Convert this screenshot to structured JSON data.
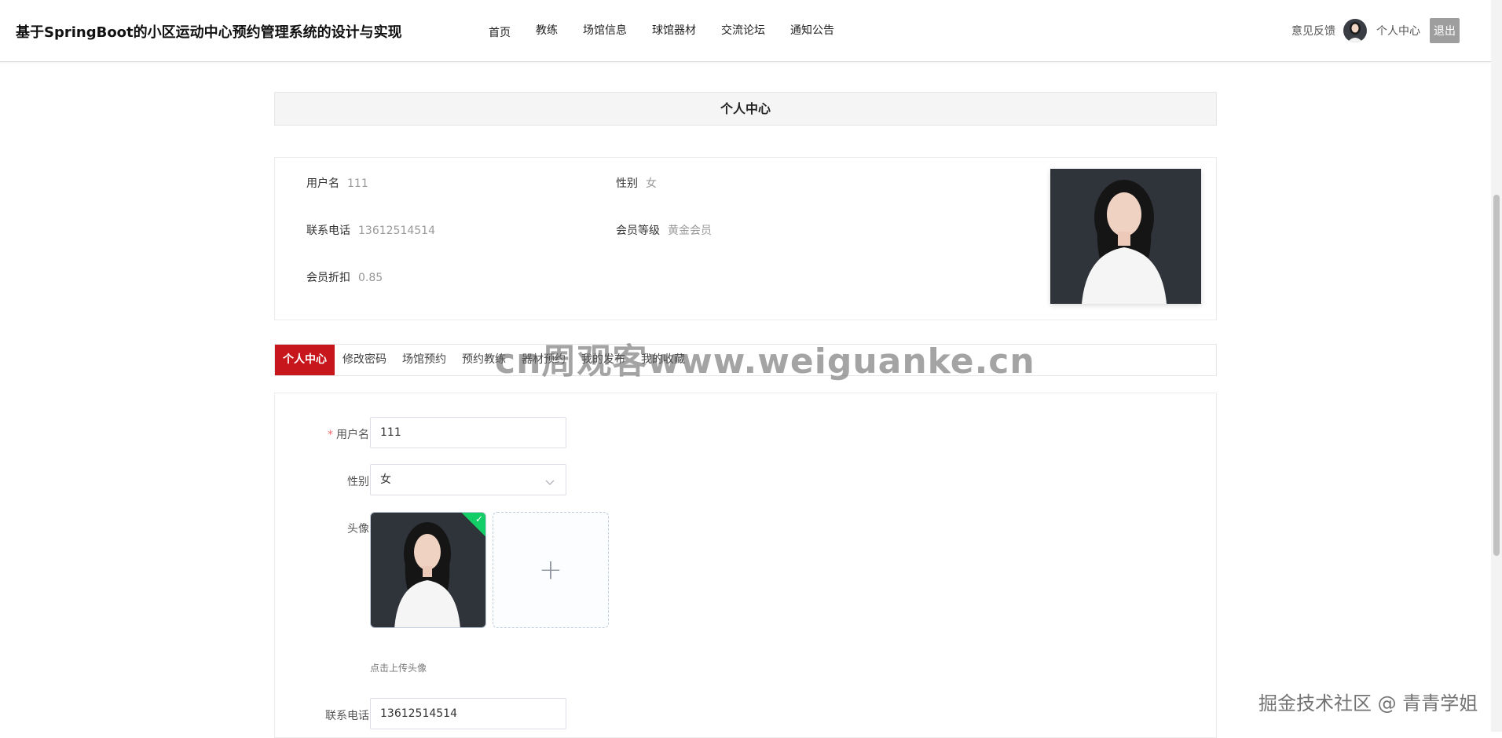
{
  "header": {
    "site_title": "基于SpringBoot的小区运动中心预约管理系统的设计与实现",
    "nav": [
      "首页",
      "教练",
      "场馆信息",
      "球馆器材",
      "交流论坛",
      "通知公告"
    ],
    "feedback": "意见反馈",
    "user_center": "个人中心",
    "logout": "退出"
  },
  "page_title": "个人中心",
  "profile": {
    "username_label": "用户名",
    "username": "111",
    "gender_label": "性别",
    "gender": "女",
    "phone_label": "联系电话",
    "phone": "13612514514",
    "level_label": "会员等级",
    "level": "黄金会员",
    "discount_label": "会员折扣",
    "discount": "0.85"
  },
  "tabs": [
    "个人中心",
    "修改密码",
    "场馆预约",
    "预约教练",
    "器材预约",
    "我的发布",
    "我的收藏"
  ],
  "form": {
    "username_label": "用户名",
    "username_value": "111",
    "gender_label": "性别",
    "gender_value": "女",
    "avatar_label": "头像",
    "upload_hint": "点击上传头像",
    "phone_label": "联系电话",
    "phone_value": "13612514514"
  },
  "watermark": "cn周观客www.weiguanke.cn",
  "corner_watermark": "掘金技术社区 @ 青青学姐",
  "colors": {
    "accent": "#c8161d",
    "success": "#13ce66"
  },
  "icons": [
    "user-avatar-icon",
    "chevron-down-icon",
    "check-icon",
    "plus-icon"
  ]
}
